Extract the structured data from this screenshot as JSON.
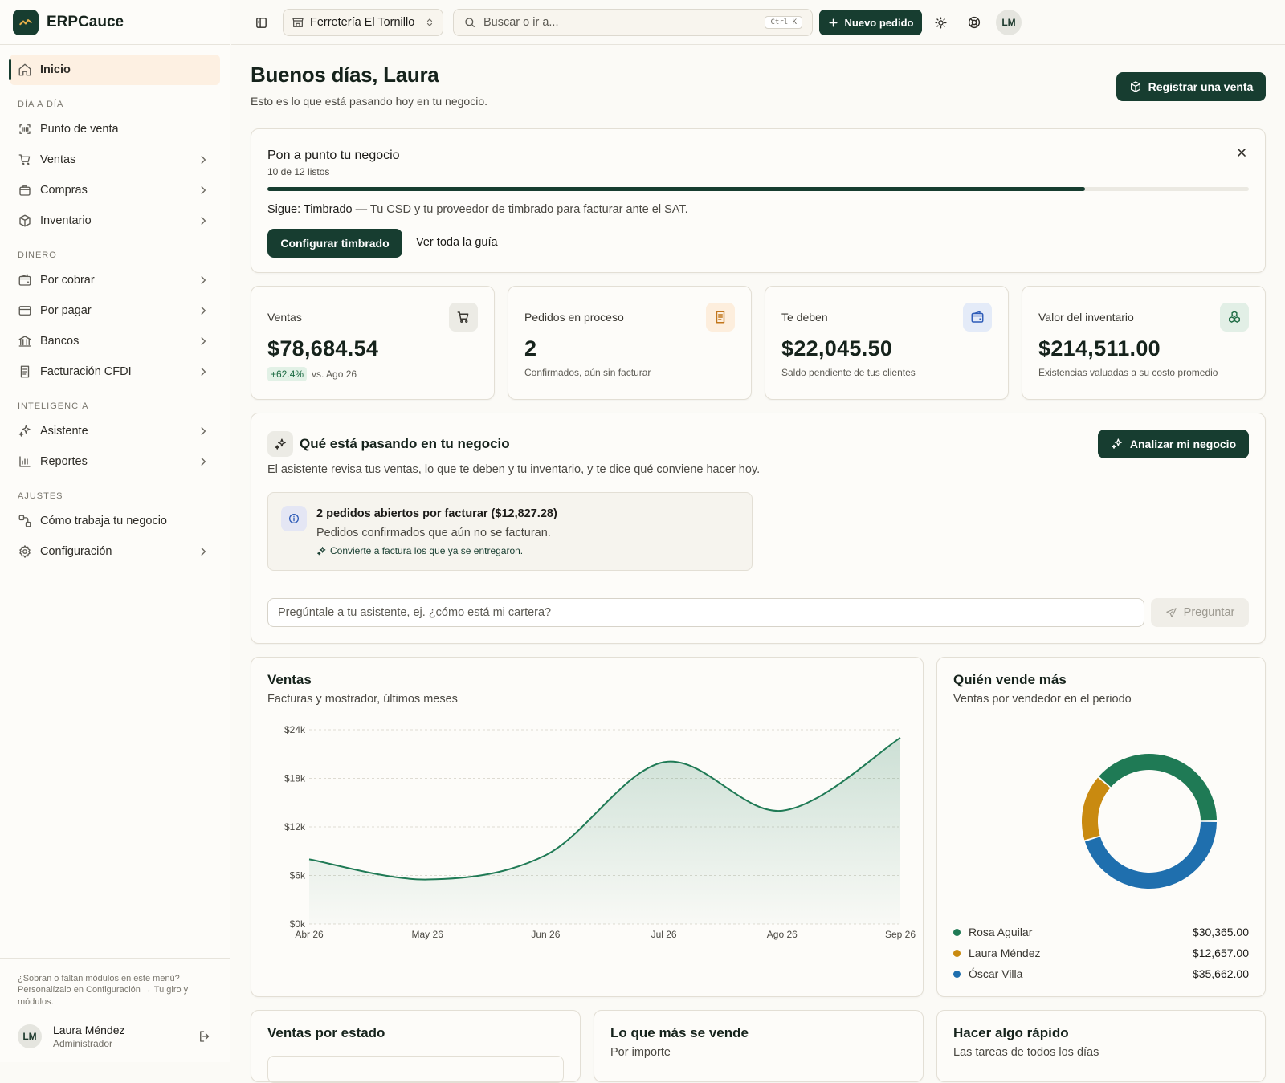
{
  "app": {
    "name": "ERPCauce"
  },
  "sidebar": {
    "home": "Inicio",
    "sections": [
      {
        "title": "DÍA A DÍA",
        "items": [
          {
            "label": "Punto de venta",
            "icon": "scan-icon",
            "chevron": false
          },
          {
            "label": "Ventas",
            "icon": "cart-icon",
            "chevron": true
          },
          {
            "label": "Compras",
            "icon": "bag-icon",
            "chevron": true
          },
          {
            "label": "Inventario",
            "icon": "box-icon",
            "chevron": true
          }
        ]
      },
      {
        "title": "DINERO",
        "items": [
          {
            "label": "Por cobrar",
            "icon": "wallet-icon",
            "chevron": true
          },
          {
            "label": "Por pagar",
            "icon": "card-icon",
            "chevron": true
          },
          {
            "label": "Bancos",
            "icon": "bank-icon",
            "chevron": true
          },
          {
            "label": "Facturación CFDI",
            "icon": "invoice-icon",
            "chevron": true
          }
        ]
      },
      {
        "title": "INTELIGENCIA",
        "items": [
          {
            "label": "Asistente",
            "icon": "sparkles-icon",
            "chevron": true
          },
          {
            "label": "Reportes",
            "icon": "bar-chart-icon",
            "chevron": true
          }
        ]
      },
      {
        "title": "AJUSTES",
        "items": [
          {
            "label": "Cómo trabaja tu negocio",
            "icon": "workflow-icon",
            "chevron": false
          },
          {
            "label": "Configuración",
            "icon": "gear-icon",
            "chevron": true
          }
        ]
      }
    ],
    "footer_hint": "¿Sobran o faltan módulos en este menú? Personalízalo en Configuración → Tu giro y módulos.",
    "user": {
      "initials": "LM",
      "name": "Laura Méndez",
      "role": "Administrador"
    }
  },
  "topbar": {
    "store": "Ferretería El Tornillo",
    "search_placeholder": "Buscar o ir a...",
    "shortcut": "Ctrl K",
    "new_order": "Nuevo pedido",
    "avatar": "LM"
  },
  "page": {
    "greeting": "Buenos días, Laura",
    "subtitle": "Esto es lo que está pasando hoy en tu negocio.",
    "register_sale": "Registrar una venta"
  },
  "setup": {
    "title": "Pon a punto tu negocio",
    "progress_text": "10 de 12 listos",
    "progress_fraction": 0.833,
    "next_label": "Sigue: Timbrado",
    "next_desc": " — Tu CSD y tu proveedor de timbrado para facturar ante el SAT.",
    "primary_btn": "Configurar timbrado",
    "link": "Ver toda la guía"
  },
  "kpis": [
    {
      "label": "Ventas",
      "value": "$78,684.54",
      "badge": "+62.4%",
      "sub": "vs. Ago 26",
      "icon": "cart-icon",
      "icon_bg": "#ecebe5",
      "icon_color": "#3a3832"
    },
    {
      "label": "Pedidos en proceso",
      "value": "2",
      "badge": "",
      "sub": "Confirmados, aún sin facturar",
      "icon": "document-icon",
      "icon_bg": "#fdeedd",
      "icon_color": "#c2761b"
    },
    {
      "label": "Te deben",
      "value": "$22,045.50",
      "badge": "",
      "sub": "Saldo pendiente de tus clientes",
      "icon": "wallet-icon",
      "icon_bg": "#e4ebf8",
      "icon_color": "#2d5bb7"
    },
    {
      "label": "Valor del inventario",
      "value": "$214,511.00",
      "badge": "",
      "sub": "Existencias valuadas a su costo promedio",
      "icon": "boxes-icon",
      "icon_bg": "#e2efe6",
      "icon_color": "#1d6b43"
    }
  ],
  "assistant": {
    "title": "Qué está pasando en tu negocio",
    "desc": "El asistente revisa tus ventas, lo que te deben y tu inventario, y te dice qué conviene hacer hoy.",
    "analyze_btn": "Analizar mi negocio",
    "insight": {
      "title": "2 pedidos abiertos por facturar ($12,827.28)",
      "body": "Pedidos confirmados que aún no se facturan.",
      "action": "Convierte a factura los que ya se entregaron."
    },
    "ask_placeholder": "Pregúntale a tu asistente, ej. ¿cómo está mi cartera?",
    "ask_btn": "Preguntar"
  },
  "sales_chart": {
    "title": "Ventas",
    "subtitle": "Facturas y mostrador, últimos meses"
  },
  "chart_data": [
    {
      "type": "area",
      "title": "Ventas",
      "subtitle": "Facturas y mostrador, últimos meses",
      "categories": [
        "Abr 26",
        "May 26",
        "Jun 26",
        "Jul 26",
        "Ago 26",
        "Sep 26"
      ],
      "values": [
        8000,
        5500,
        8500,
        20000,
        14000,
        23000
      ],
      "y_ticks": [
        "$0k",
        "$6k",
        "$12k",
        "$18k",
        "$24k"
      ],
      "ylim": [
        0,
        24000
      ],
      "color": "#1f7a55",
      "grid": true
    },
    {
      "type": "pie",
      "title": "Quién vende más",
      "subtitle": "Ventas por vendedor en el periodo",
      "series": [
        {
          "name": "Rosa Aguilar",
          "value": 30365.0,
          "label": "$30,365.00",
          "color": "#1f7a55"
        },
        {
          "name": "Laura Méndez",
          "value": 12657.0,
          "label": "$12,657.00",
          "color": "#c98a10"
        },
        {
          "name": "Óscar Villa",
          "value": 35662.0,
          "label": "$35,662.00",
          "color": "#1f6fae"
        }
      ]
    }
  ],
  "bottom_cards": [
    {
      "title": "Ventas por estado",
      "subtitle": ""
    },
    {
      "title": "Lo que más se vende",
      "subtitle": "Por importe"
    },
    {
      "title": "Hacer algo rápido",
      "subtitle": "Las tareas de todos los días"
    }
  ]
}
